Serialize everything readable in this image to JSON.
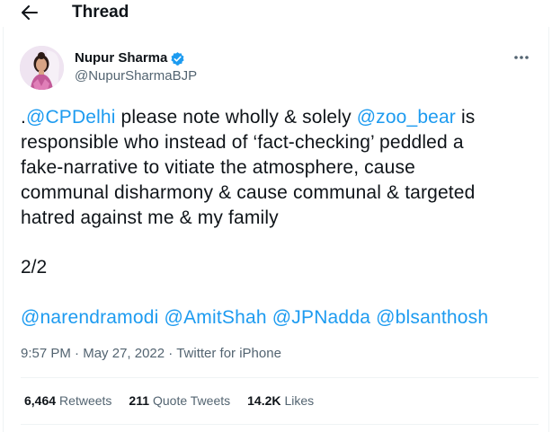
{
  "header": {
    "title": "Thread",
    "back_icon": "arrow-left-icon"
  },
  "author": {
    "name": "Nupur Sharma",
    "handle": "@NupurSharmaBJP",
    "verified_icon": "verified-badge-icon",
    "more_icon": "more-horizontal-icon"
  },
  "tweet": {
    "line1": {
      "t1": ".",
      "m1": "@CPDelhi",
      "t2": " please note wholly & solely ",
      "m2": "@zoo_bear",
      "t3": " is"
    },
    "line2": "responsible who instead of ‘fact-checking’ peddled a",
    "line3": "fake-narrative to vitiate the atmosphere, cause",
    "line4": "communal disharmony & cause communal & targeted",
    "line5": "hatred against me & my family",
    "count": "2/2",
    "tags": [
      "@narendramodi",
      "@AmitShah",
      "@JPNadda",
      "@blsanthosh"
    ]
  },
  "meta": {
    "time": "9:57 PM",
    "sep1": "·",
    "date": "May 27, 2022",
    "sep2": "·",
    "source": "Twitter for iPhone"
  },
  "stats": {
    "retweets_count": "6,464",
    "retweets_label": "Retweets",
    "quotes_count": "211",
    "quotes_label": "Quote Tweets",
    "likes_count": "14.2K",
    "likes_label": "Likes"
  },
  "colors": {
    "accent": "#1d9bf0",
    "text": "#0f1419",
    "secondary": "#536471",
    "divider": "#eff3f4"
  }
}
